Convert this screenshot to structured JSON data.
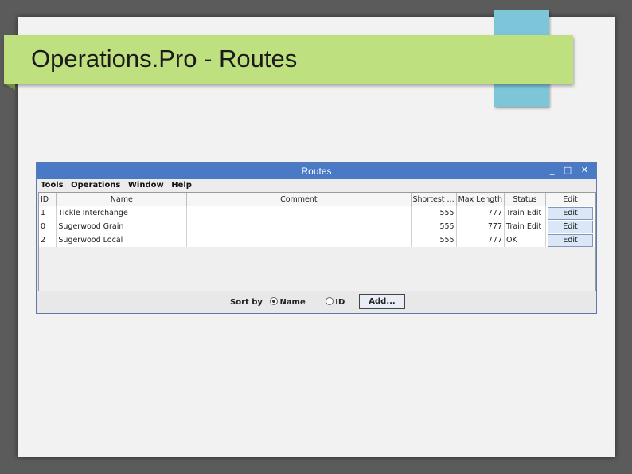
{
  "slide": {
    "title": "Operations.Pro - Routes"
  },
  "window": {
    "title": "Routes",
    "controls": "_ □ ✕",
    "menu": [
      "Tools",
      "Operations",
      "Window",
      "Help"
    ],
    "columns": [
      "ID",
      "Name",
      "Comment",
      "Shortest ...",
      "Max Length",
      "Status",
      "Edit"
    ],
    "rows": [
      {
        "id": "1",
        "name": "Tickle Interchange",
        "comment": "",
        "shortest": "555",
        "max_length": "777",
        "status": "Train Edit",
        "edit": "Edit"
      },
      {
        "id": "0",
        "name": "Sugerwood Grain",
        "comment": "",
        "shortest": "555",
        "max_length": "777",
        "status": "Train Edit",
        "edit": "Edit"
      },
      {
        "id": "2",
        "name": "Sugerwood Local",
        "comment": "",
        "shortest": "555",
        "max_length": "777",
        "status": "OK",
        "edit": "Edit"
      }
    ],
    "sort": {
      "label": "Sort by",
      "option_name": "Name",
      "option_id": "ID",
      "selected": "Name"
    },
    "add_label": "Add..."
  }
}
